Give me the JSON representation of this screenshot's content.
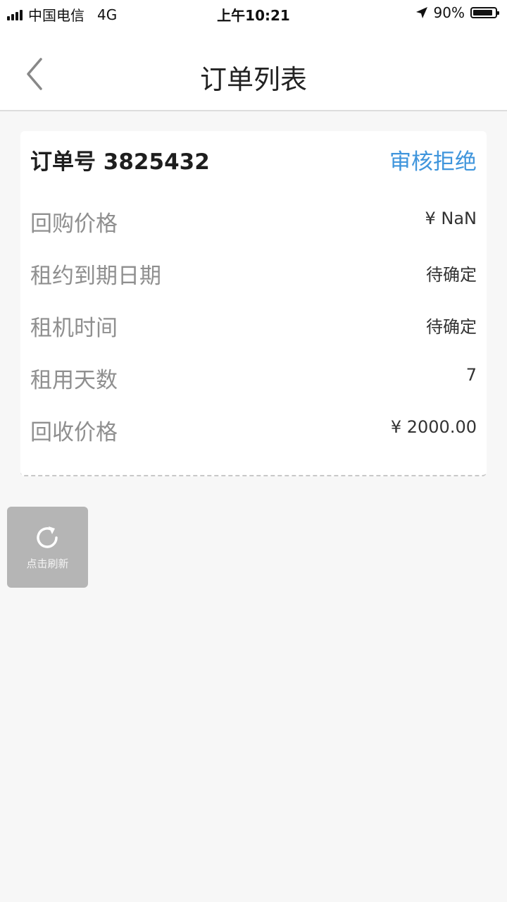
{
  "status_bar": {
    "carrier": "中国电信",
    "network": "4G",
    "time": "上午10:21",
    "battery_percent": "90%",
    "battery_level": 0.9
  },
  "nav": {
    "title": "订单列表",
    "back_icon": "chevron-left-icon"
  },
  "order": {
    "number_text": "订单号 3825432",
    "status": "审核拒绝",
    "status_color": "#3f95dc",
    "rows": [
      {
        "label": "回购价格",
        "value": "¥ NaN"
      },
      {
        "label": "租约到期日期",
        "value": "待确定"
      },
      {
        "label": "租机时间",
        "value": "待确定"
      },
      {
        "label": "租用天数",
        "value": "7"
      },
      {
        "label": "回收价格",
        "value": "¥ 2000.00"
      }
    ]
  },
  "refresh": {
    "label": "点击刷新",
    "icon": "refresh-icon"
  }
}
